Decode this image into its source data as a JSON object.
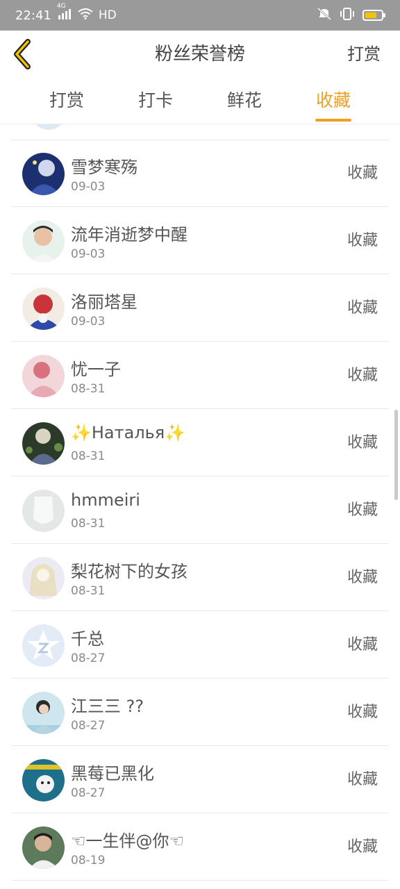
{
  "status_bar": {
    "time": "22:41",
    "network": "4G",
    "hd": "HD"
  },
  "header": {
    "title": "粉丝荣誉榜",
    "right_action": "打赏"
  },
  "tabs": [
    {
      "label": "打赏",
      "active": false
    },
    {
      "label": "打卡",
      "active": false
    },
    {
      "label": "鲜花",
      "active": false
    },
    {
      "label": "收藏",
      "active": true
    }
  ],
  "accent_color": "#f0a020",
  "list": [
    {
      "name": "雪梦寒殇",
      "date": "09-03",
      "action": "收藏"
    },
    {
      "name": "流年消逝梦中醒",
      "date": "09-03",
      "action": "收藏"
    },
    {
      "name": "洛丽塔星",
      "date": "09-03",
      "action": "收藏"
    },
    {
      "name": "忧一子",
      "date": "08-31",
      "action": "收藏"
    },
    {
      "name": "✨Наталья✨",
      "date": "08-31",
      "action": "收藏"
    },
    {
      "name": "hmmeiri",
      "date": "08-31",
      "action": "收藏"
    },
    {
      "name": "梨花树下的女孩",
      "date": "08-31",
      "action": "收藏"
    },
    {
      "name": "千总",
      "date": "08-27",
      "action": "收藏"
    },
    {
      "name": "江三三 ??",
      "date": "08-27",
      "action": "收藏"
    },
    {
      "name": "黑莓已黑化",
      "date": "08-27",
      "action": "收藏"
    },
    {
      "name": "☜一生伴@你☜",
      "date": "08-19",
      "action": "收藏"
    }
  ]
}
